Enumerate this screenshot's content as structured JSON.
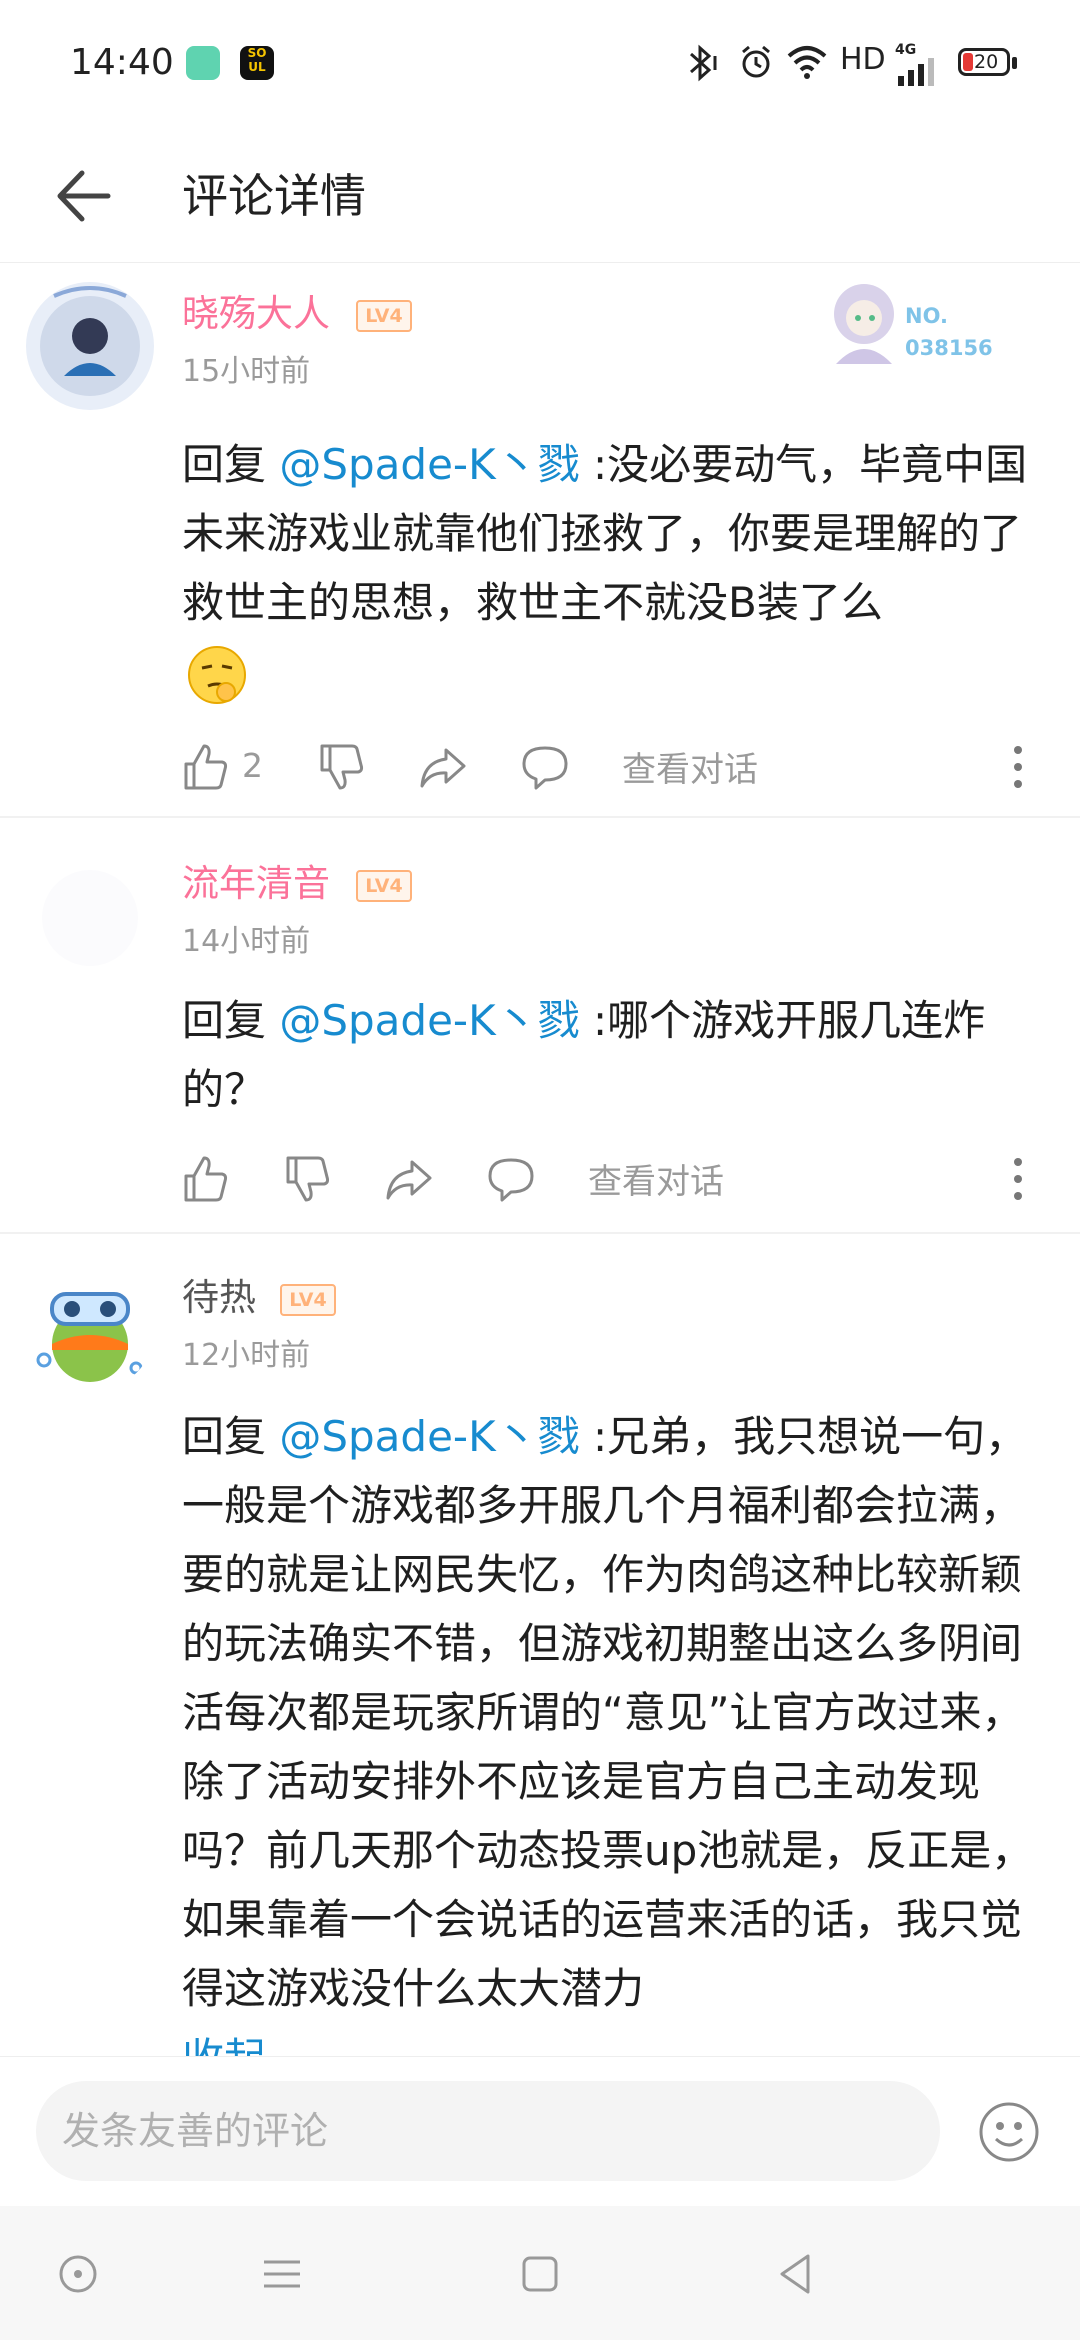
{
  "status_bar": {
    "time": "14:40",
    "network": "HD",
    "signal_label": "4G",
    "battery": "20"
  },
  "header": {
    "title": "评论详情"
  },
  "comments": [
    {
      "username": "晓殇大人",
      "level": "LV4",
      "time": "15小时前",
      "reply_prefix": "回复 ",
      "mention": "@Spade-K丶戮",
      "text": " :没必要动气，毕竟中国未来游戏业就靠他们拯救了，你要是理解的了救世主的思想，救世主不就没B装了么",
      "likes": "2",
      "view_dialog": "查看对话",
      "badge": "NO.\n038156"
    },
    {
      "username": "流年清音",
      "level": "LV4",
      "time": "14小时前",
      "reply_prefix": "回复 ",
      "mention": "@Spade-K丶戮",
      "text": " :哪个游戏开服几连炸的？",
      "view_dialog": "查看对话"
    },
    {
      "username": "待热",
      "level": "LV4",
      "time": "12小时前",
      "reply_prefix": "回复 ",
      "mention": "@Spade-K丶戮",
      "text": " :兄弟，我只想说一句，一般是个游戏都多开服几个月福利都会拉满，要的就是让网民失忆，作为肉鸽这种比较新颖的玩法确实不错，但游戏初期整出这么多阴间活每次都是玩家所谓的“意见”让官方改过来，除了活动安排外不应该是官方自己主动发现吗？前几天那个动态投票up池就是，反正是，如果靠着一个会说话的运营来活的话，我只觉得这游戏没什么太大潜力",
      "collapse": "收起"
    }
  ],
  "input": {
    "placeholder": "发条友善的评论"
  },
  "colors": {
    "accent_pink": "#fb7299",
    "mention_blue": "#178bcf",
    "level_orange": "#ffb27a",
    "meta_gray": "#9a9a9a"
  }
}
